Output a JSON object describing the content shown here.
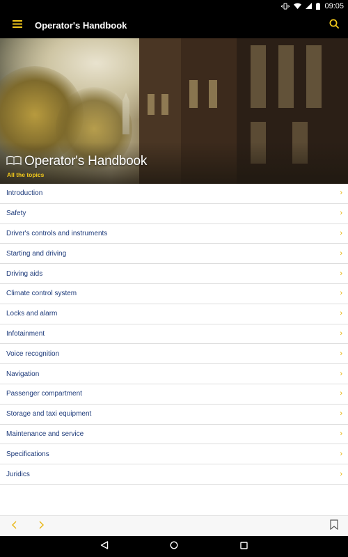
{
  "status_bar": {
    "time": "09:05",
    "icons": [
      "vibrate-icon",
      "wifi-icon",
      "signal-icon",
      "battery-icon"
    ]
  },
  "app_bar": {
    "title": "Operator's Handbook",
    "menu_icon": "hamburger-menu-icon",
    "search_icon": "search-icon",
    "accent_color": "#f3c91b"
  },
  "hero": {
    "title": "Operator's Handbook",
    "subtitle": "All the topics"
  },
  "topics": [
    {
      "label": "Introduction"
    },
    {
      "label": "Safety"
    },
    {
      "label": "Driver's controls and instruments"
    },
    {
      "label": "Starting and driving"
    },
    {
      "label": "Driving aids"
    },
    {
      "label": "Climate control system"
    },
    {
      "label": "Locks and alarm"
    },
    {
      "label": "Infotainment"
    },
    {
      "label": "Voice recognition"
    },
    {
      "label": "Navigation"
    },
    {
      "label": "Passenger compartment"
    },
    {
      "label": "Storage and taxi equipment"
    },
    {
      "label": "Maintenance and service"
    },
    {
      "label": "Specifications"
    },
    {
      "label": "Juridics"
    }
  ],
  "toolbar": {
    "prev_icon": "chevron-left-icon",
    "next_icon": "chevron-right-icon",
    "bookmark_icon": "bookmark-icon"
  },
  "system_nav": {
    "back_icon": "back-triangle-icon",
    "home_icon": "home-circle-icon",
    "recents_icon": "recents-square-icon"
  }
}
